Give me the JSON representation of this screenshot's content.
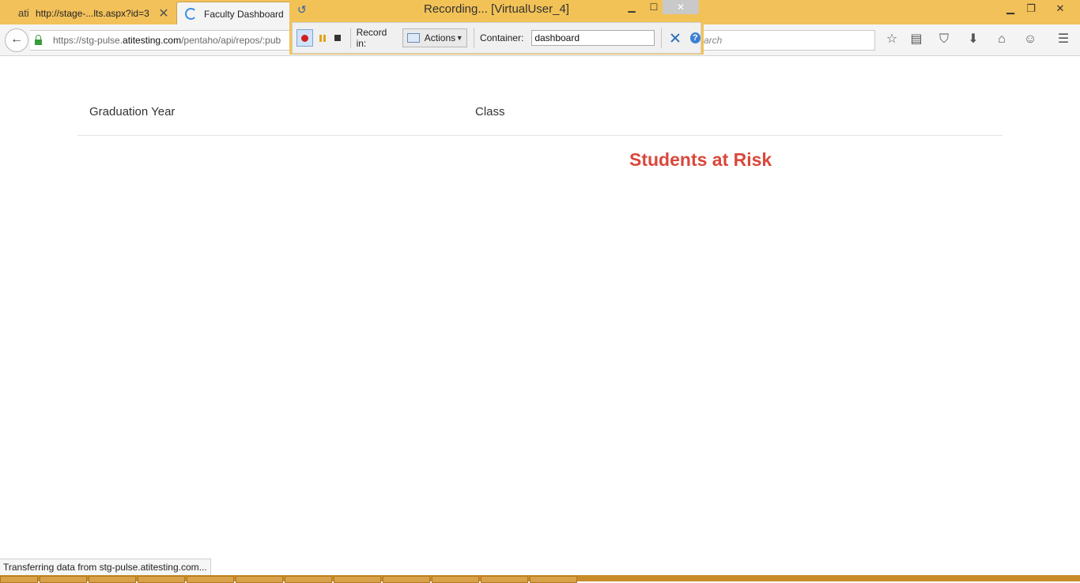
{
  "browser": {
    "tabs": [
      {
        "title": "http://stage-...lts.aspx?id=3",
        "favicon": "ati"
      },
      {
        "title": "Faculty Dashboard"
      }
    ],
    "url": {
      "prefix": "https://stg-pulse.",
      "host": "atitesting.com",
      "path": "/pentaho/api/repos/:pub"
    },
    "search_placeholder": "arch",
    "status_text": "Transferring data from stg-pulse.atitesting.com..."
  },
  "recorder": {
    "title": "Recording... [VirtualUser_4]",
    "record_in_label": "Record in:",
    "record_in_value": "Actions",
    "container_label": "Container:",
    "container_value": "dashboard",
    "help_glyph": "?"
  },
  "page": {
    "filter_graduation_year": "Graduation Year",
    "filter_class": "Class",
    "section_title": "Students at Risk"
  },
  "colors": {
    "tabstrip": "#f3c15a",
    "accent_red": "#d9483b"
  }
}
